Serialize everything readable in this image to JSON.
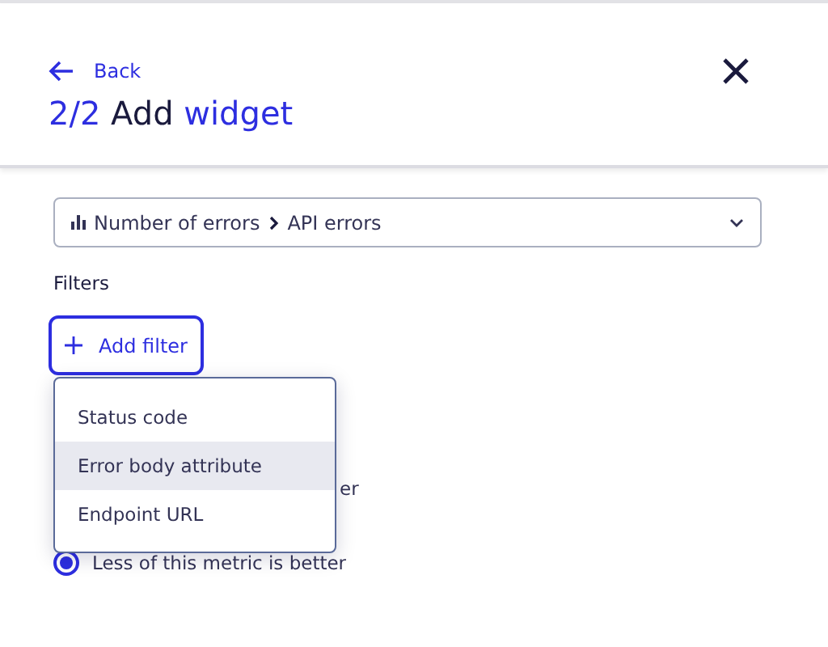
{
  "header": {
    "back": "Back",
    "title": {
      "step": "2/2",
      "verb": "Add",
      "noun": "widget"
    }
  },
  "metric_select": {
    "value": [
      "Number of errors",
      "API errors"
    ]
  },
  "filters": {
    "label": "Filters",
    "add_button": "Add filter",
    "menu": [
      {
        "label": "Status code",
        "selected": false
      },
      {
        "label": "Error body attribute",
        "selected": true
      },
      {
        "label": "Endpoint URL",
        "selected": false
      }
    ]
  },
  "direction_options": [
    {
      "label": "er",
      "kind": "partial"
    },
    {
      "label": "Less of this metric is better",
      "selected": true,
      "kind": "full"
    }
  ]
}
